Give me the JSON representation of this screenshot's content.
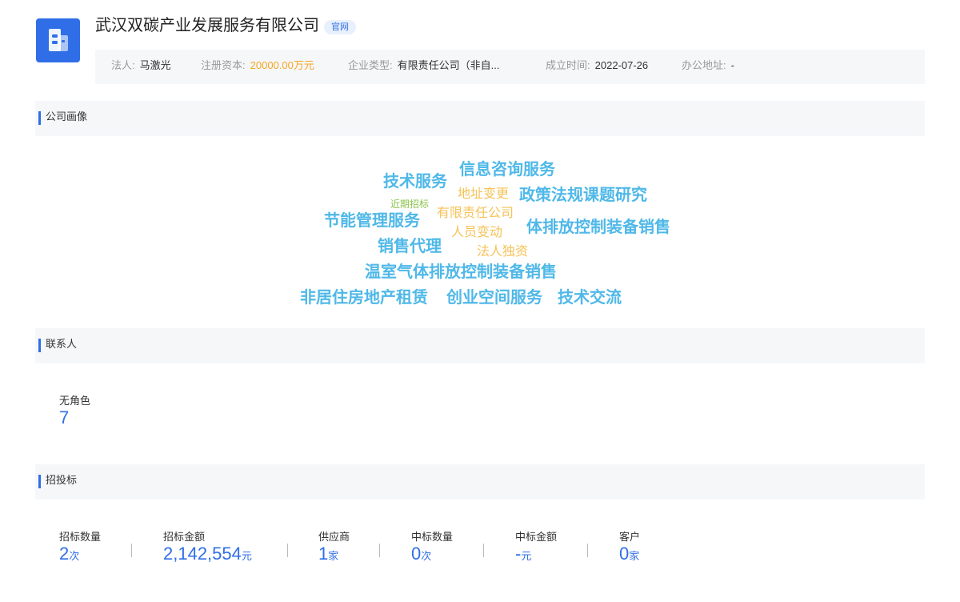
{
  "company": {
    "name": "武汉双碳产业发展服务有限公司",
    "official_tag": "官网",
    "legal_rep_label": "法人:",
    "legal_rep": "马激光",
    "capital_label": "注册资本:",
    "capital": "20000.00万元",
    "type_label": "企业类型:",
    "type": "有限责任公司（非自...",
    "founded_label": "成立时间:",
    "founded": "2022-07-26",
    "address_label": "办公地址:",
    "address": "-"
  },
  "portrait": {
    "title": "公司画像",
    "tags": [
      {
        "text": "技术服务",
        "color": "blue"
      },
      {
        "text": "信息咨询服务",
        "color": "blue"
      },
      {
        "text": "近期招标",
        "color": "green"
      },
      {
        "text": "地址变更",
        "color": "orange"
      },
      {
        "text": "政策法规课题研究",
        "color": "blue"
      },
      {
        "text": "节能管理服务",
        "color": "blue"
      },
      {
        "text": "有限责任公司",
        "color": "orange"
      },
      {
        "text": "体排放控制装备销售",
        "color": "blue"
      },
      {
        "text": "人员变动",
        "color": "orange"
      },
      {
        "text": "销售代理",
        "color": "blue"
      },
      {
        "text": "法人独资",
        "color": "orange"
      },
      {
        "text": "温室气体排放控制装备销售",
        "color": "blue"
      },
      {
        "text": "非居住房地产租赁",
        "color": "blue"
      },
      {
        "text": "创业空间服务",
        "color": "blue"
      },
      {
        "text": "技术交流",
        "color": "blue"
      }
    ]
  },
  "contacts": {
    "title": "联系人",
    "role_label": "无角色",
    "role_count": "7"
  },
  "bidding": {
    "title": "招投标",
    "stats": [
      {
        "label": "招标数量",
        "value": "2",
        "unit": "次"
      },
      {
        "label": "招标金额",
        "value": "2,142,554",
        "unit": "元"
      },
      {
        "label": "供应商",
        "value": "1",
        "unit": "家"
      },
      {
        "label": "中标数量",
        "value": "0",
        "unit": "次"
      },
      {
        "label": "中标金额",
        "value": "-",
        "unit": "元"
      },
      {
        "label": "客户",
        "value": "0",
        "unit": "家"
      }
    ]
  },
  "colors": {
    "accent": "#2f6ee6",
    "tag_blue": "#4fb8e8",
    "tag_orange": "#f6c257",
    "tag_green": "#8bc34a"
  },
  "icons": {
    "logo": "building-icon"
  }
}
